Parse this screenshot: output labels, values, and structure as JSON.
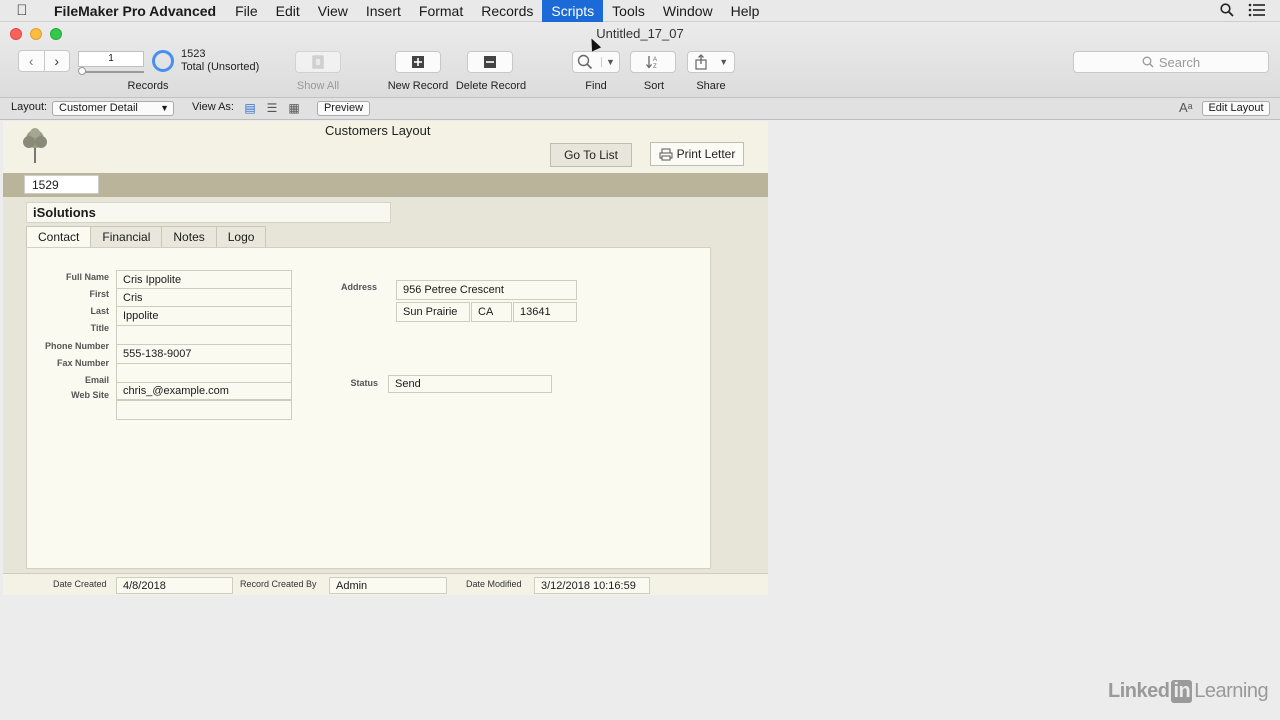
{
  "menubar": {
    "app_name": "FileMaker Pro Advanced",
    "items": [
      "File",
      "Edit",
      "View",
      "Insert",
      "Format",
      "Records",
      "Scripts",
      "Tools",
      "Window",
      "Help"
    ],
    "active_item": "Scripts"
  },
  "window": {
    "title": "Untitled_17_07"
  },
  "toolbar": {
    "record_number": "1",
    "found_count": "1523",
    "found_status": "Total (Unsorted)",
    "records_label": "Records",
    "show_all_label": "Show All",
    "new_record_label": "New Record",
    "delete_record_label": "Delete Record",
    "find_label": "Find",
    "sort_label": "Sort",
    "share_label": "Share",
    "search_placeholder": "Search"
  },
  "layoutbar": {
    "layout_label": "Layout:",
    "layout_value": "Customer Detail",
    "view_as_label": "View As:",
    "preview_label": "Preview",
    "edit_layout_label": "Edit Layout"
  },
  "form": {
    "title": "Customers Layout",
    "go_to_list_label": "Go To List",
    "print_letter_label": "Print Letter",
    "customer_id": "1529",
    "company": "iSolutions",
    "tabs": [
      "Contact",
      "Financial",
      "Notes",
      "Logo"
    ],
    "active_tab": "Contact",
    "labels": {
      "full_name": "Full Name",
      "first": "First",
      "last": "Last",
      "title": "Title",
      "phone": "Phone Number",
      "fax": "Fax Number",
      "email": "Email",
      "website": "Web Site",
      "address": "Address",
      "status": "Status"
    },
    "values": {
      "full_name": "Cris Ippolite",
      "first": "Cris",
      "last": "Ippolite",
      "title": "",
      "phone": "555-138-9007",
      "fax": "",
      "email": "chris_@example.com",
      "website": "",
      "street": "956 Petree Crescent",
      "city": "Sun Prairie",
      "state": "CA",
      "zip": "13641",
      "status": "Send"
    }
  },
  "footer": {
    "date_created_label": "Date Created",
    "date_created": "4/8/2018",
    "created_by_label": "Record Created By",
    "created_by": "Admin",
    "date_modified_label": "Date Modified",
    "date_modified": "3/12/2018 10:16:59"
  },
  "watermark": {
    "part1": "Linked",
    "part2": "in",
    "part3": "Learning"
  }
}
